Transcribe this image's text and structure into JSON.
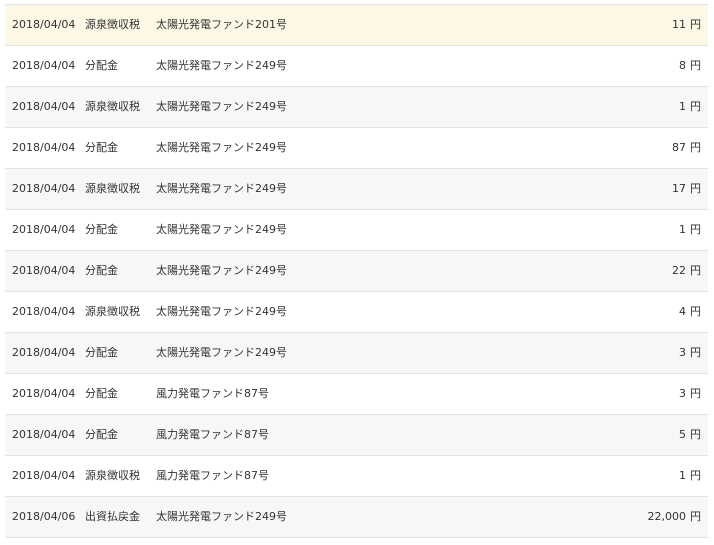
{
  "rows": [
    {
      "date": "2018/04/04",
      "type": "源泉徴収税",
      "fund": "太陽光発電ファンド201号",
      "amount": "11",
      "unit": "円",
      "style": "highlight"
    },
    {
      "date": "2018/04/04",
      "type": "分配金",
      "fund": "太陽光発電ファンド249号",
      "amount": "8",
      "unit": "円",
      "style": "plain"
    },
    {
      "date": "2018/04/04",
      "type": "源泉徴収税",
      "fund": "太陽光発電ファンド249号",
      "amount": "1",
      "unit": "円",
      "style": "alt"
    },
    {
      "date": "2018/04/04",
      "type": "分配金",
      "fund": "太陽光発電ファンド249号",
      "amount": "87",
      "unit": "円",
      "style": "plain"
    },
    {
      "date": "2018/04/04",
      "type": "源泉徴収税",
      "fund": "太陽光発電ファンド249号",
      "amount": "17",
      "unit": "円",
      "style": "alt"
    },
    {
      "date": "2018/04/04",
      "type": "分配金",
      "fund": "太陽光発電ファンド249号",
      "amount": "1",
      "unit": "円",
      "style": "plain"
    },
    {
      "date": "2018/04/04",
      "type": "分配金",
      "fund": "太陽光発電ファンド249号",
      "amount": "22",
      "unit": "円",
      "style": "alt"
    },
    {
      "date": "2018/04/04",
      "type": "源泉徴収税",
      "fund": "太陽光発電ファンド249号",
      "amount": "4",
      "unit": "円",
      "style": "plain"
    },
    {
      "date": "2018/04/04",
      "type": "分配金",
      "fund": "太陽光発電ファンド249号",
      "amount": "3",
      "unit": "円",
      "style": "alt"
    },
    {
      "date": "2018/04/04",
      "type": "分配金",
      "fund": "風力発電ファンド87号",
      "amount": "3",
      "unit": "円",
      "style": "plain"
    },
    {
      "date": "2018/04/04",
      "type": "分配金",
      "fund": "風力発電ファンド87号",
      "amount": "5",
      "unit": "円",
      "style": "alt"
    },
    {
      "date": "2018/04/04",
      "type": "源泉徴収税",
      "fund": "風力発電ファンド87号",
      "amount": "1",
      "unit": "円",
      "style": "plain"
    },
    {
      "date": "2018/04/06",
      "type": "出資払戻金",
      "fund": "太陽光発電ファンド249号",
      "amount": "22,000",
      "unit": "円",
      "style": "alt"
    }
  ],
  "colors": {
    "highlight_row": "#fdf8e5",
    "alt_row": "#f7f7f7",
    "border": "#e4e4e4",
    "text": "#333333"
  }
}
